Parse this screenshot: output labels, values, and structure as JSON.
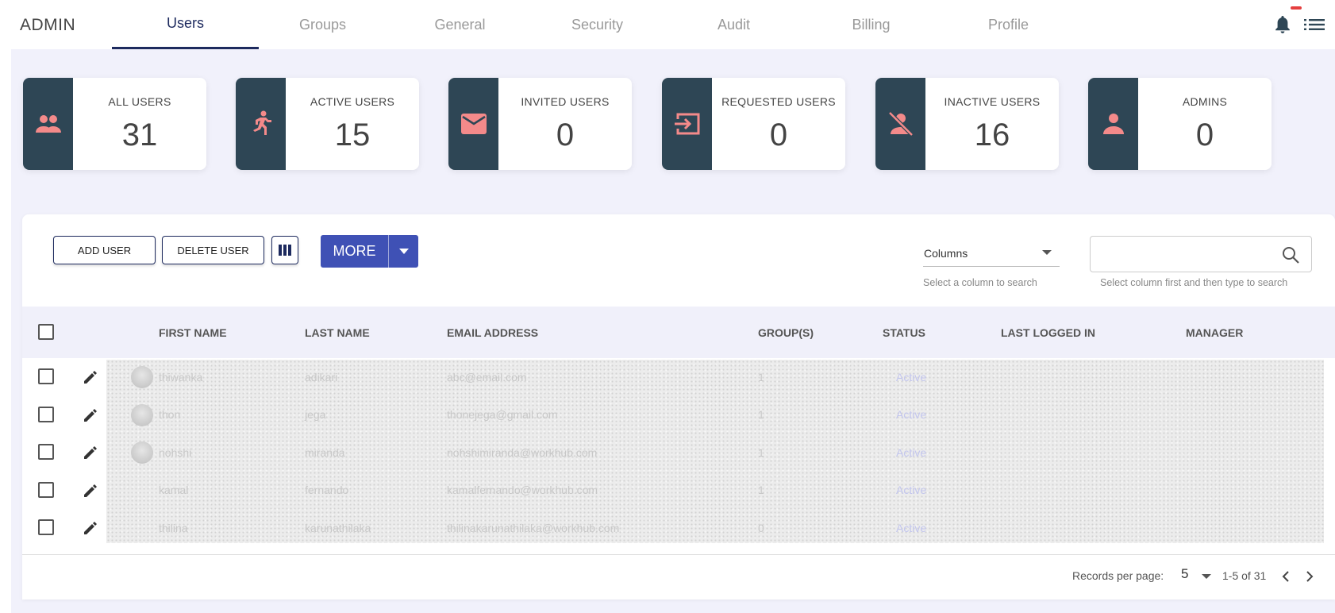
{
  "brand": "ADMIN",
  "tabs": [
    {
      "label": "Users"
    },
    {
      "label": "Groups"
    },
    {
      "label": "General"
    },
    {
      "label": "Security"
    },
    {
      "label": "Audit"
    },
    {
      "label": "Billing"
    },
    {
      "label": "Profile"
    }
  ],
  "stats": [
    {
      "label": "ALL USERS",
      "value": "31",
      "icon": "people-icon"
    },
    {
      "label": "ACTIVE USERS",
      "value": "15",
      "icon": "running-person-icon"
    },
    {
      "label": "INVITED USERS",
      "value": "0",
      "icon": "envelope-icon"
    },
    {
      "label": "REQUESTED USERS",
      "value": "0",
      "icon": "login-arrow-icon"
    },
    {
      "label": "INACTIVE USERS",
      "value": "16",
      "icon": "person-off-icon"
    },
    {
      "label": "ADMINS",
      "value": "0",
      "icon": "person-icon"
    }
  ],
  "toolbar": {
    "add_user": "ADD USER",
    "delete_user": "DELETE USER",
    "more": "MORE",
    "columns_select": "Columns",
    "columns_hint": "Select a column to search",
    "search_placeholder": "",
    "search_hint": "Select column first and then type to search"
  },
  "table": {
    "headers": [
      "FIRST NAME",
      "LAST NAME",
      "EMAIL ADDRESS",
      "GROUP(S)",
      "STATUS",
      "LAST LOGGED IN",
      "MANAGER"
    ],
    "rows": [
      {
        "first": "thiwanka",
        "last": "adikari",
        "email": "abc@email.com",
        "groups": "1",
        "status": "Active"
      },
      {
        "first": "thon",
        "last": "jega",
        "email": "thonejega@gmail.com",
        "groups": "1",
        "status": "Active"
      },
      {
        "first": "nohshi",
        "last": "miranda",
        "email": "nohshimiranda@workhub.com",
        "groups": "1",
        "status": "Active"
      },
      {
        "first": "kamal",
        "last": "fernando",
        "email": "kamalfernando@workhub.com",
        "groups": "1",
        "status": "Active"
      },
      {
        "first": "thilina",
        "last": "karunathilaka",
        "email": "thilinakarunathilaka@workhub.com",
        "groups": "0",
        "status": "Active"
      }
    ]
  },
  "footer": {
    "records_label": "Records per page:",
    "per_page": "5",
    "range": "1-5 of 31"
  },
  "colors": {
    "accent": "#3f51b5",
    "navy": "#1d2a5e",
    "icon_bg": "#2e4655",
    "icon_fg": "#f48a8a",
    "content_bg": "#f1f1fb"
  }
}
